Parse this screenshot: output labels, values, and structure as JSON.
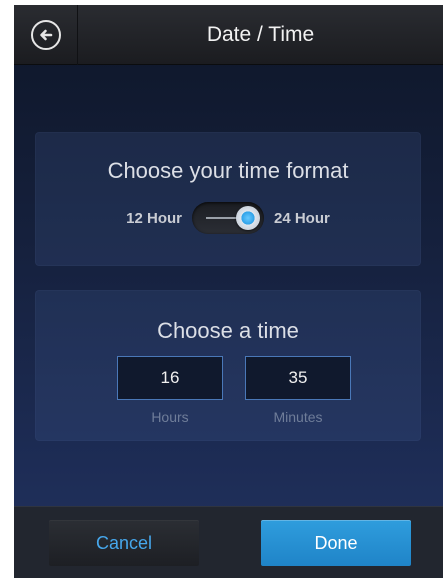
{
  "header": {
    "title": "Date / Time",
    "back_icon": "back-arrow-icon"
  },
  "format_panel": {
    "title": "Choose your time format",
    "left_label": "12 Hour",
    "right_label": "24 Hour",
    "selected": "24 Hour"
  },
  "time_panel": {
    "title": "Choose a time",
    "hours_value": "16",
    "minutes_value": "35",
    "hours_label": "Hours",
    "minutes_label": "Minutes"
  },
  "footer": {
    "cancel_label": "Cancel",
    "done_label": "Done"
  },
  "colors": {
    "accent": "#2f9ddd",
    "cancel_text": "#46a7ec",
    "field_border": "#4a78b8"
  }
}
